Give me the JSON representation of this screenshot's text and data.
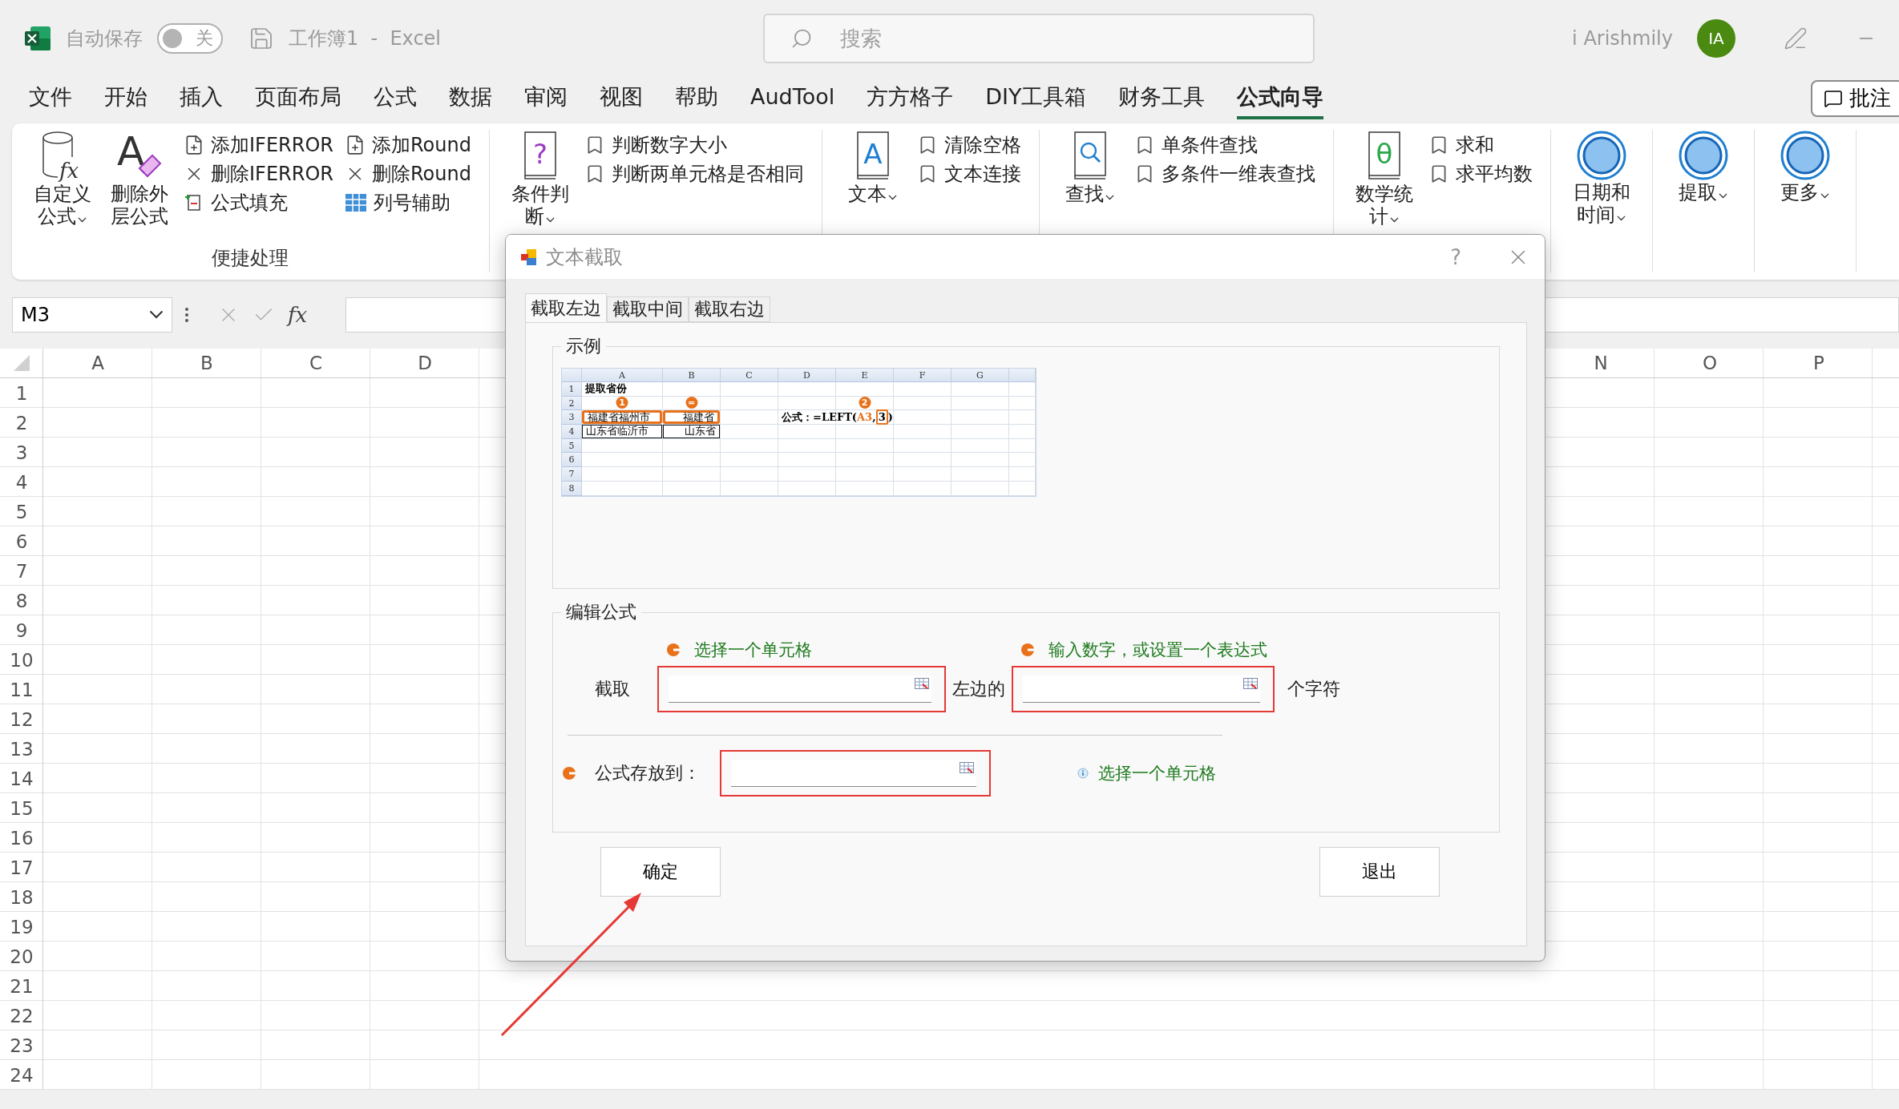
{
  "title_bar": {
    "autosave": {
      "label": "自动保存",
      "toggle_label": "关",
      "on": false
    },
    "document_title": "工作簿1  -  Excel",
    "search": {
      "placeholder": "搜索"
    },
    "user": {
      "name": "i Arishmily",
      "initials": "IA"
    }
  },
  "menu_tabs": [
    {
      "label": "文件",
      "selected": false
    },
    {
      "label": "开始",
      "selected": false
    },
    {
      "label": "插入",
      "selected": false
    },
    {
      "label": "页面布局",
      "selected": false
    },
    {
      "label": "公式",
      "selected": false
    },
    {
      "label": "数据",
      "selected": false
    },
    {
      "label": "审阅",
      "selected": false
    },
    {
      "label": "视图",
      "selected": false
    },
    {
      "label": "帮助",
      "selected": false
    },
    {
      "label": "AudTool",
      "selected": false
    },
    {
      "label": "方方格子",
      "selected": false
    },
    {
      "label": "DIY工具箱",
      "selected": false
    },
    {
      "label": "财务工具",
      "selected": false
    },
    {
      "label": "公式向导",
      "selected": true
    }
  ],
  "comments_button": {
    "label": "批注"
  },
  "ribbon": {
    "groups": [
      {
        "label": "便捷处理",
        "large": [
          {
            "label": "自定义公式",
            "kind": "cylinder",
            "glyph": "fx",
            "dropdown": true
          },
          {
            "label": "删除外层公式",
            "kind": "eraser",
            "glyph": "A",
            "dropdown": false
          }
        ],
        "columns": [
          [
            {
              "label": "添加IFERROR",
              "kind": "add-file"
            },
            {
              "label": "删除IFERROR",
              "kind": "cross"
            },
            {
              "label": "公式填充",
              "kind": "fill"
            }
          ],
          [
            {
              "label": "添加Round",
              "kind": "add-file"
            },
            {
              "label": "删除Round",
              "kind": "cross"
            },
            {
              "label": "列号辅助",
              "kind": "grid"
            }
          ]
        ]
      },
      {
        "large": [
          {
            "label": "条件判断",
            "kind": "book",
            "glyph": "?",
            "color": "#9b3cc2",
            "dropdown": true
          }
        ],
        "columns": [
          [
            {
              "label": "判断数字大小",
              "kind": "bookmark"
            },
            {
              "label": "判断两单元格是否相同",
              "kind": "bookmark"
            }
          ]
        ]
      },
      {
        "large": [
          {
            "label": "文本",
            "kind": "book",
            "glyph": "A",
            "color": "#1f7fd0",
            "dropdown": true
          }
        ],
        "columns": [
          [
            {
              "label": "清除空格",
              "kind": "bookmark"
            },
            {
              "label": "文本连接",
              "kind": "bookmark"
            }
          ]
        ]
      },
      {
        "large": [
          {
            "label": "查找",
            "kind": "book-search",
            "dropdown": true
          }
        ],
        "columns": [
          [
            {
              "label": "单条件查找",
              "kind": "bookmark"
            },
            {
              "label": "多条件一维表查找",
              "kind": "bookmark"
            }
          ]
        ]
      },
      {
        "large": [
          {
            "label": "数学统计",
            "kind": "book",
            "glyph": "θ",
            "color": "#2aa84a",
            "dropdown": true
          }
        ],
        "columns": [
          [
            {
              "label": "求和",
              "kind": "bookmark"
            },
            {
              "label": "求平均数",
              "kind": "bookmark"
            }
          ]
        ]
      },
      {
        "large": [
          {
            "label": "日期和时间",
            "kind": "circle",
            "dropdown": true
          }
        ]
      },
      {
        "large": [
          {
            "label": "提取",
            "kind": "circle",
            "dropdown": true
          }
        ]
      },
      {
        "large": [
          {
            "label": "更多",
            "kind": "circle",
            "dropdown": true
          }
        ]
      }
    ]
  },
  "formula_bar": {
    "name_box": "M3",
    "function_button": "fx"
  },
  "sheet": {
    "columns_left": [
      "A",
      "B",
      "C",
      "D"
    ],
    "columns_right": [
      "N",
      "O",
      "P"
    ],
    "rows": [
      "1",
      "2",
      "3",
      "4",
      "5",
      "6",
      "7",
      "8",
      "9",
      "10",
      "11",
      "12",
      "13",
      "14",
      "15",
      "16",
      "17",
      "18",
      "19",
      "20",
      "21",
      "22",
      "23",
      "24"
    ]
  },
  "dialog": {
    "title": "文本截取",
    "help": "?",
    "tabs": [
      {
        "label": "截取左边",
        "selected": true
      },
      {
        "label": "截取中间",
        "selected": false
      },
      {
        "label": "截取右边",
        "selected": false
      }
    ],
    "example": {
      "legend": "示例",
      "columns": [
        "A",
        "B",
        "C",
        "D",
        "E",
        "F",
        "G"
      ],
      "rows": [
        {
          "header": "1",
          "cells": [
            {
              "text": "提取省份",
              "kind": "bold"
            }
          ]
        },
        {
          "header": "2",
          "cells": [
            {
              "kind": "badge",
              "text": "1"
            },
            {
              "kind": "badge",
              "text": "="
            },
            {},
            {},
            {
              "kind": "badge",
              "text": "2"
            }
          ]
        },
        {
          "header": "3",
          "cells": [
            {
              "text": "福建省福州市",
              "kind": "highlighted"
            },
            {
              "text": "福建省",
              "kind": "highlighted"
            },
            {},
            {
              "kind": "formula",
              "parts": [
                {
                  "text": "公式：=LEFT(",
                  "kind": "plain"
                },
                {
                  "text": "A3",
                  "kind": "ref"
                },
                {
                  "text": ",",
                  "kind": "plain"
                },
                {
                  "text": "3",
                  "kind": "boxed"
                },
                {
                  "text": ")",
                  "kind": "plain"
                }
              ]
            }
          ]
        },
        {
          "header": "4",
          "cells": [
            {
              "text": "山东省临沂市",
              "kind": "bordered"
            },
            {
              "text": "山东省",
              "kind": "bordered"
            }
          ]
        },
        {
          "header": "5"
        },
        {
          "header": "6"
        },
        {
          "header": "7"
        },
        {
          "header": "8"
        }
      ]
    },
    "edit": {
      "legend": "编辑公式",
      "source_hint": "选择一个单元格",
      "count_hint": "输入数字，或设置一个表达式",
      "extract_label": "截取",
      "middle_label": "左边的",
      "suffix_label": "个字符",
      "output_label": "公式存放到：",
      "output_hint": "选择一个单元格"
    },
    "buttons": {
      "ok": "确定",
      "exit": "退出"
    }
  }
}
